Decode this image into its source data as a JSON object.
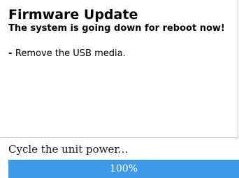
{
  "dialog": {
    "title": "Firmware Update",
    "subtitle": "The system is going down for reboot now!",
    "instructions": [
      {
        "bullet": "-",
        "text": "Remove the USB media."
      }
    ]
  },
  "status": {
    "text": "Cycle the unit power..."
  },
  "progress": {
    "value_percent": 100,
    "label": "100%",
    "fill_color": "#3d9ae8"
  }
}
